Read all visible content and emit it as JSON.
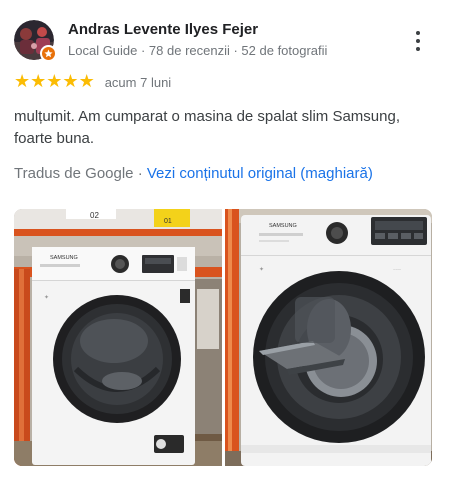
{
  "review": {
    "author_name": "Andras Levente Ilyes Fejer",
    "author_meta": "Local Guide · 78 de recenzii · 52 de fotografii",
    "rating": 5,
    "stars": [
      "★",
      "★",
      "★",
      "★",
      "★"
    ],
    "time": "acum 7 luni",
    "text": "mulțumit. Am cumparat o masina de spalat slim Samsung, foarte buna.",
    "translated_by": "Tradus de Google",
    "separator": "·",
    "view_original": "Vezi conținutul original (maghiară)"
  },
  "photos": [
    {
      "brand": "SAMSUNG",
      "tags": [
        "02",
        "01"
      ],
      "description": "front-loading washing machine, door closed"
    },
    {
      "brand": "SAMSUNG",
      "description": "front-loading washing machine, AddWash door open"
    }
  ],
  "colors": {
    "star": "#fbbc04",
    "link": "#1a73e8",
    "meta": "#70757a",
    "text": "#3c4043",
    "badge": "#e8710a",
    "shelf_orange": "#d9531e"
  },
  "icons": {
    "more": "more-vert-icon",
    "guide_badge": "local-guide-badge-icon"
  }
}
